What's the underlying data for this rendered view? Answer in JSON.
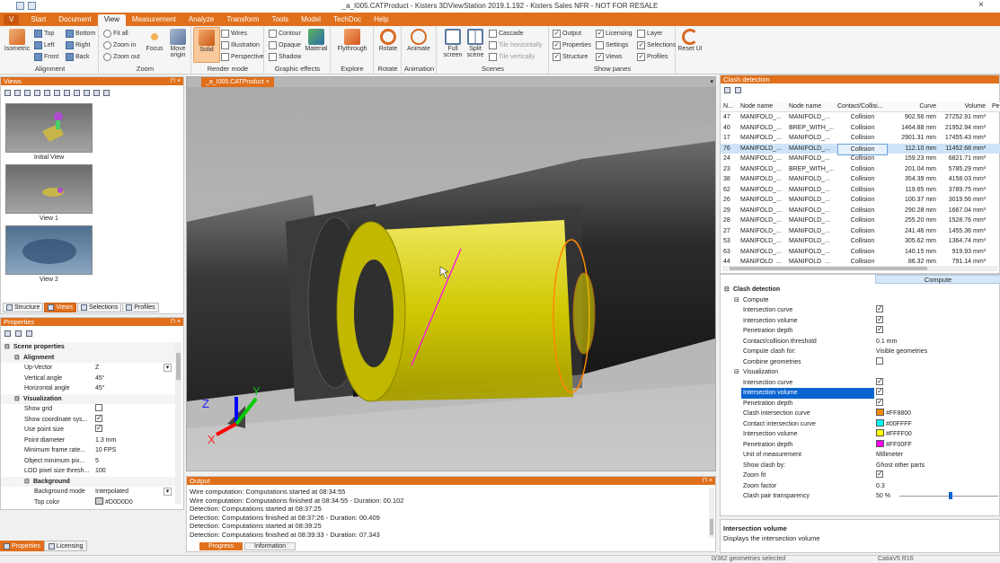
{
  "window": {
    "title": "_a_I005.CATProduct - Kisters 3DViewStation 2019.1.192 - Kisters Sales NFR - NOT FOR RESALE",
    "close": "×"
  },
  "menu": {
    "app_button": "V",
    "items": [
      "Start",
      "Document",
      "View",
      "Measurement",
      "Analyze",
      "Transform",
      "Tools",
      "Model",
      "TechDoc",
      "Help"
    ],
    "active": "View"
  },
  "ribbon": {
    "alignment": {
      "label": "Alignment",
      "isometric": "Isometric",
      "top": "Top",
      "bottom": "Bottom",
      "left": "Left",
      "right": "Right",
      "front": "Front",
      "back": "Back"
    },
    "zoom": {
      "label": "Zoom",
      "fit_all": "Fit all",
      "zoom_in": "Zoom in",
      "zoom_out": "Zoom out",
      "focus": "Focus",
      "move_origin": "Move origin"
    },
    "render_mode": {
      "label": "Render mode",
      "solid": "Solid",
      "wires": "Wires",
      "illustration": "Illustration",
      "perspective": "Perspective"
    },
    "graphic_effects": {
      "label": "Graphic effects",
      "contour": "Contour",
      "opaque": "Opaque",
      "shadow": "Shadow",
      "material": "Material"
    },
    "explore": {
      "label": "Explore",
      "flythrough": "Flythrough"
    },
    "rotate": {
      "label": "Rotate",
      "rotate": "Rotate"
    },
    "animation": {
      "label": "Animation",
      "animate": "Animate"
    },
    "scenes": {
      "label": "Scenes",
      "full_screen": "Full screen",
      "split_scene": "Split scene",
      "cascade": "Cascade",
      "tile_h": "Tile horizontally",
      "tile_v": "Tile vertically"
    },
    "show_panes": {
      "label": "Show panes",
      "output": "Output",
      "licensing": "Licensing",
      "layer": "Layer",
      "properties": "Properties",
      "settings": "Settings",
      "selections": "Selections",
      "structure": "Structure",
      "views": "Views",
      "profiles": "Profiles"
    },
    "reset": {
      "label": "Reset UI"
    }
  },
  "views_panel": {
    "title": "Views",
    "views": [
      "Initial View",
      "View 1",
      "View 2"
    ],
    "tabs": [
      "Structure",
      "Views",
      "Selections",
      "Profiles"
    ]
  },
  "properties_panel": {
    "title": "Properties",
    "rows": [
      {
        "key": "Scene properties",
        "value": "",
        "level": 0,
        "section": true
      },
      {
        "key": "Alignment",
        "value": "",
        "level": 1,
        "section": true
      },
      {
        "key": "Up-Vector",
        "value": "Z",
        "level": 2
      },
      {
        "key": "Vertical angle",
        "value": "45°",
        "level": 2
      },
      {
        "key": "Horizontal angle",
        "value": "45°",
        "level": 2
      },
      {
        "key": "Visualization",
        "value": "",
        "level": 1,
        "section": true
      },
      {
        "key": "Show grid",
        "value": "",
        "level": 2,
        "check": false
      },
      {
        "key": "Show coordinate sys...",
        "value": "",
        "level": 2,
        "check": true
      },
      {
        "key": "Use point size",
        "value": "",
        "level": 2,
        "check": true
      },
      {
        "key": "Point diameter",
        "value": "1.3 mm",
        "level": 2
      },
      {
        "key": "Minimum frame rate...",
        "value": "10 FPS",
        "level": 2
      },
      {
        "key": "Object minimum pix...",
        "value": "5",
        "level": 2
      },
      {
        "key": "LOD pixel size thresh...",
        "value": "100",
        "level": 2
      },
      {
        "key": "Background",
        "value": "",
        "level": 2,
        "section": true
      },
      {
        "key": "Background mode",
        "value": "Interpolated",
        "level": 3
      },
      {
        "key": "Top color",
        "value": "#D0D0D0",
        "level": 3,
        "swatch": "#D0D0D0"
      }
    ],
    "tabs": [
      "Properties",
      "Licensing"
    ]
  },
  "viewport": {
    "doc_tab": "_a_I005.CATProduct",
    "axes": {
      "x": "X",
      "y": "Y",
      "z": "Z"
    }
  },
  "output": {
    "title": "Output",
    "lines": [
      "Wire computation: Computations started at 08:34:55",
      "Wire computation: Computations finished at 08:34:55 - Duration: 00.102",
      "Detection: Computations started at 08:37:25",
      "Detection: Computations finished at 08:37:26 - Duration: 00.409",
      "Detection: Computations started at 08:39:25",
      "Detection: Computations finished at 08:39:33 - Duration: 07.343"
    ],
    "tabs": [
      "Progress",
      "Information"
    ]
  },
  "clash_panel": {
    "title": "Clash detection",
    "columns": [
      "N...",
      "Node name",
      "Node name",
      "Contact/Collisi...",
      "Curve",
      "Volume",
      "Pe"
    ],
    "rows": [
      [
        "47",
        "MANIFOLD_...",
        "MANIFOLD_...",
        "Collision",
        "902.56 mm",
        "27252.91 mm³"
      ],
      [
        "40",
        "MANIFOLD_...",
        "BREP_WITH_...",
        "Collision",
        "1464.88 mm",
        "21952.94 mm³"
      ],
      [
        "17",
        "MANIFOLD_...",
        "MANIFOLD_...",
        "Collision",
        "2901.31 mm",
        "17455.43 mm³"
      ],
      [
        "76",
        "MANIFOLD_...",
        "MANIFOLD_...",
        "Collision",
        "112.10 mm",
        "11452.68 mm³"
      ],
      [
        "24",
        "MANIFOLD_...",
        "MANIFOLD_...",
        "Collision",
        "159.23 mm",
        "6821.71 mm³"
      ],
      [
        "23",
        "MANIFOLD_...",
        "BREP_WITH_...",
        "Collision",
        "201.04 mm",
        "5785.29 mm³"
      ],
      [
        "38",
        "MANIFOLD_...",
        "MANIFOLD_...",
        "Collision",
        "354.39 mm",
        "4158.03 mm³"
      ],
      [
        "62",
        "MANIFOLD_...",
        "MANIFOLD_...",
        "Collision",
        "119.65 mm",
        "3789.75 mm³"
      ],
      [
        "26",
        "MANIFOLD_...",
        "MANIFOLD_...",
        "Collision",
        "100.37 mm",
        "3019.56 mm³"
      ],
      [
        "29",
        "MANIFOLD_...",
        "MANIFOLD_...",
        "Collision",
        "290.28 mm",
        "1667.04 mm³"
      ],
      [
        "28",
        "MANIFOLD_...",
        "MANIFOLD_...",
        "Collision",
        "255.20 mm",
        "1528.76 mm³"
      ],
      [
        "27",
        "MANIFOLD_...",
        "MANIFOLD_...",
        "Collision",
        "241.46 mm",
        "1455.36 mm³"
      ],
      [
        "53",
        "MANIFOLD_...",
        "MANIFOLD_...",
        "Collision",
        "305.62 mm",
        "1364.74 mm³"
      ],
      [
        "63",
        "MANIFOLD_...",
        "MANIFOLD_...",
        "Collision",
        "140.15 mm",
        "919.93 mm³"
      ],
      [
        "44",
        "MANIFOLD_...",
        "MANIFOLD_...",
        "Collision",
        "86.32 mm",
        "791.14 mm³"
      ]
    ],
    "selected_index": 3
  },
  "clash_props": {
    "compute_button": "Compute",
    "rows": [
      {
        "key": "Clash detection",
        "level": 0,
        "section": true
      },
      {
        "key": "Compute",
        "level": 1,
        "section": true
      },
      {
        "key": "Intersection curve",
        "level": 2,
        "check": true
      },
      {
        "key": "Intersection volume",
        "level": 2,
        "check": true
      },
      {
        "key": "Penetration depth",
        "level": 2,
        "check": true
      },
      {
        "key": "Contact/collision threshold",
        "level": 2,
        "value": "0.1 mm"
      },
      {
        "key": "Compute clash for:",
        "level": 2,
        "value": "Visible geometries"
      },
      {
        "key": "Combine geometries",
        "level": 2,
        "check": false
      },
      {
        "key": "Visualization",
        "level": 1,
        "section": true
      },
      {
        "key": "Intersection curve",
        "level": 2,
        "check": true
      },
      {
        "key": "Intersection volume",
        "level": 2,
        "check": true,
        "selected": true
      },
      {
        "key": "Penetration depth",
        "level": 2,
        "check": true
      },
      {
        "key": "Clash intersection curve",
        "level": 2,
        "value": "#FF8800",
        "swatch": "#FF8800"
      },
      {
        "key": "Contact intersection curve",
        "level": 2,
        "value": "#00FFFF",
        "swatch": "#00FFFF"
      },
      {
        "key": "Intersection volume",
        "level": 2,
        "value": "#FFFF00",
        "swatch": "#FFFF00"
      },
      {
        "key": "Penetration depth",
        "level": 2,
        "value": "#FF00FF",
        "swatch": "#FF00FF"
      },
      {
        "key": "Unit of measurement",
        "level": 2,
        "value": "Millimeter"
      },
      {
        "key": "Show clash by:",
        "level": 2,
        "value": "Ghost other parts"
      },
      {
        "key": "Zoom fit",
        "level": 2,
        "check": true
      },
      {
        "key": "Zoom factor",
        "level": 2,
        "value": "0.3"
      },
      {
        "key": "Clash pair transparency",
        "level": 2,
        "value": "50 %",
        "slider": 0.5
      }
    ]
  },
  "description": {
    "title": "Intersection volume",
    "text": "Displays the intersection volume"
  },
  "status": {
    "left": "0/362 geometries selected",
    "right": "CatiaV5 R16"
  },
  "colors": {
    "accent": "#E0701C",
    "selected": "#0A64D0",
    "volume": "#FFFF00",
    "curve": "#FF8800",
    "depth": "#FF00FF"
  }
}
